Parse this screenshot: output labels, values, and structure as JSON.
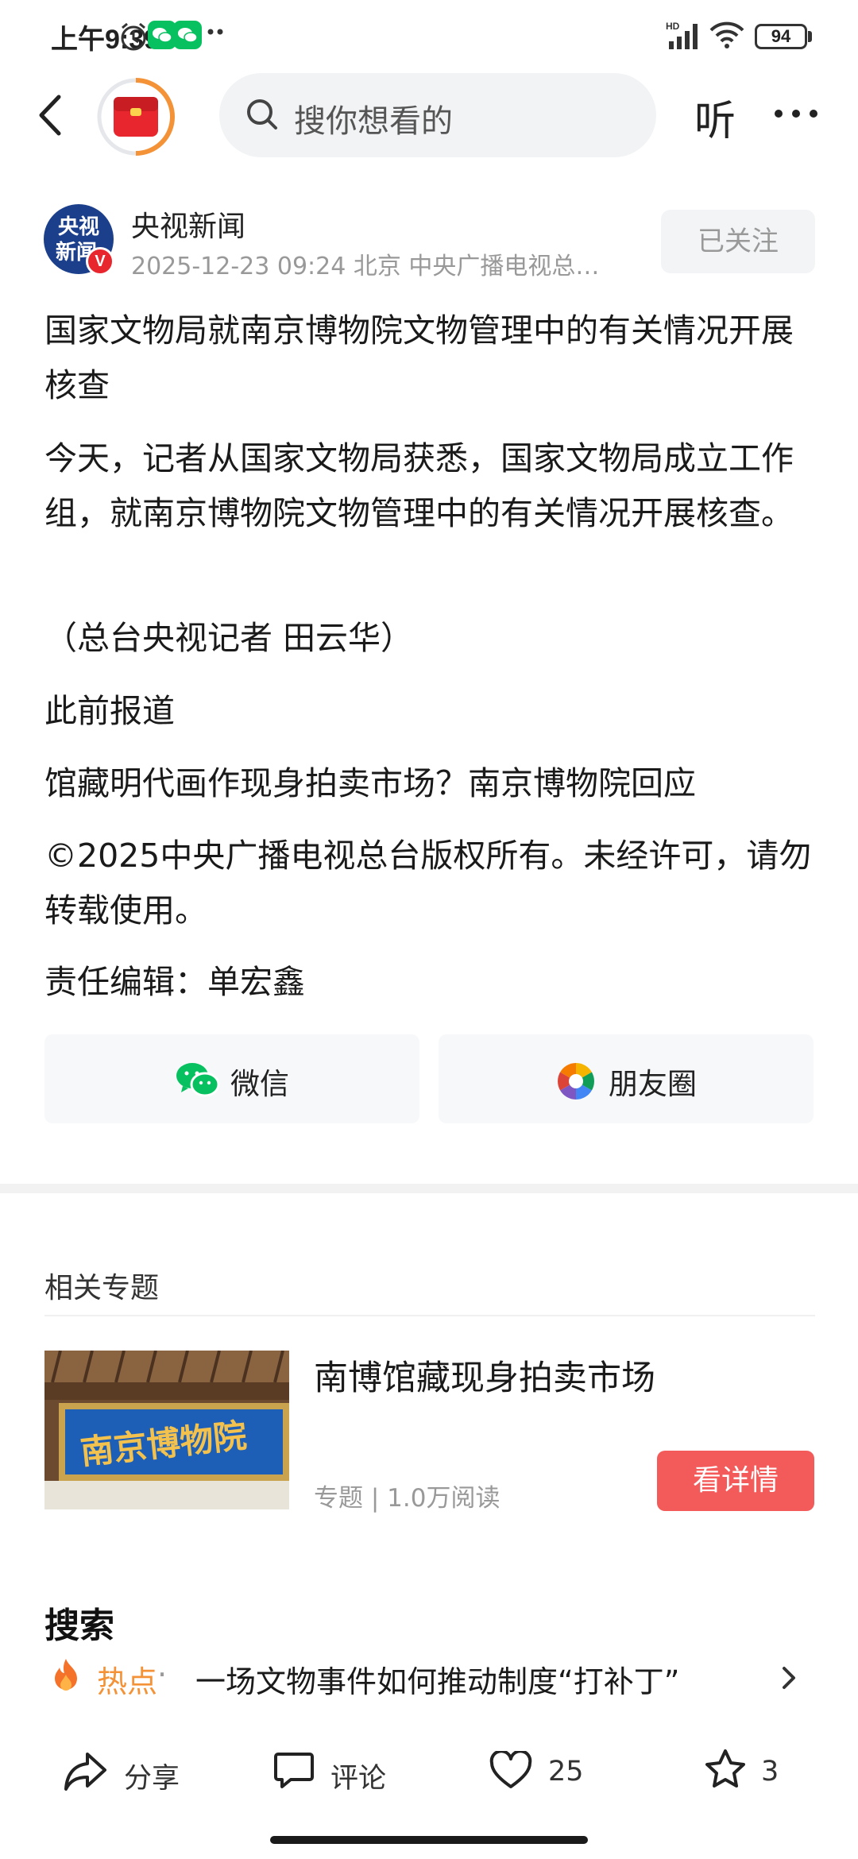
{
  "status_bar": {
    "time": "上午9:39",
    "hd_label": "HD",
    "battery": "94"
  },
  "nav": {
    "search_placeholder": "搜你想看的",
    "listen_label": "听"
  },
  "author": {
    "name": "央视新闻",
    "avatar_text_top": "央视",
    "avatar_text_bottom": "新闻",
    "verified_mark": "V",
    "meta": "2025-12-23  09:24  北京  中央广播电视总…",
    "follow_label": "已关注"
  },
  "article": {
    "paragraphs": [
      "国家文物局就南京博物院文物管理中的有关情况开展核查",
      "今天，记者从国家文物局获悉，国家文物局成立工作组，就南京博物院文物管理中的有关情况开展核查。",
      "（总台央视记者 田云华）",
      "此前报道",
      "馆藏明代画作现身拍卖市场？南京博物院回应",
      "©2025中央广播电视总台版权所有。未经许可，请勿转载使用。",
      "责任编辑：单宏鑫"
    ]
  },
  "share": {
    "wechat_label": "微信",
    "moments_label": "朋友圈"
  },
  "related": {
    "section_title": "相关专题",
    "topic_title": "南博馆藏现身拍卖市场",
    "topic_meta": "专题 | 1.0万阅读",
    "thumb_sign_text": "南京博物院",
    "detail_button": "看详情"
  },
  "search_section": {
    "heading": "搜索",
    "hot_label": "热点",
    "separator": "·",
    "hot_query": "一场文物事件如何推动制度“打补丁”"
  },
  "bottom_bar": {
    "share_label": "分享",
    "comment_label": "评论",
    "like_count": "25",
    "favorite_count": "3"
  },
  "colors": {
    "accent_red": "#f35a5a",
    "hot_orange": "#f39237",
    "wechat_green": "#07c160"
  }
}
